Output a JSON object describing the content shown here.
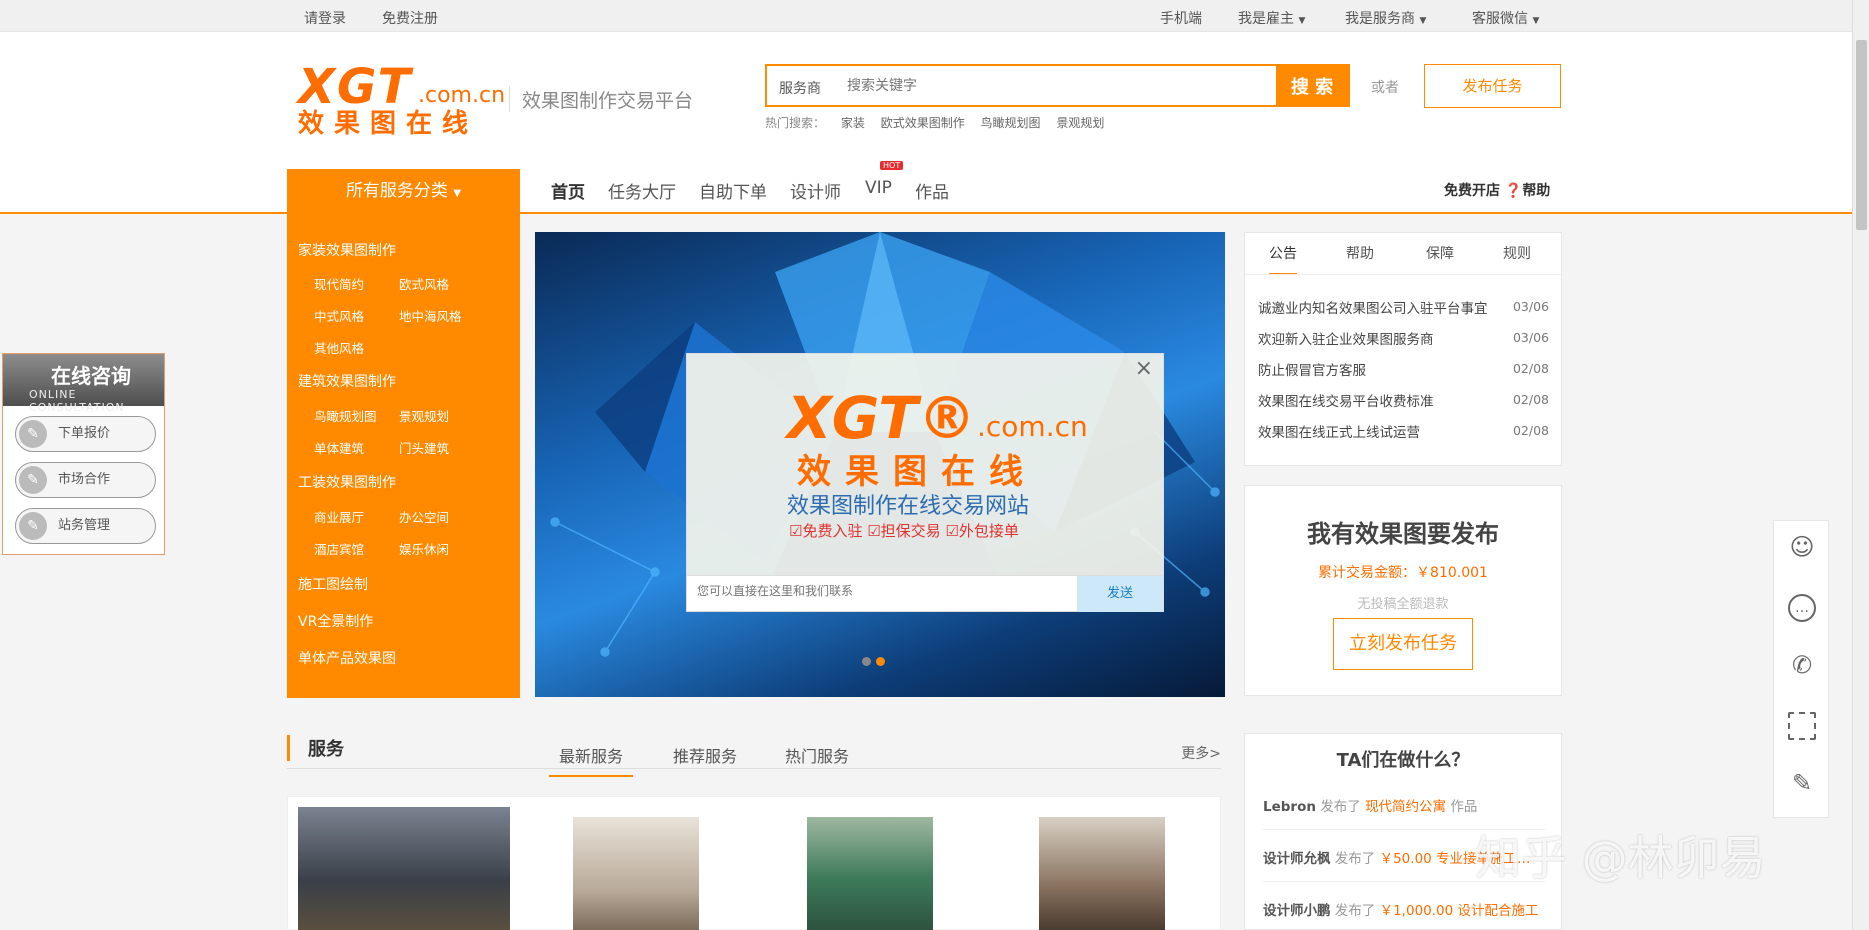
{
  "topbar": {
    "login": "请登录",
    "register": "免费注册",
    "mobile": "手机端",
    "employer": "我是雇主",
    "provider": "我是服务商",
    "wechat": "客服微信"
  },
  "logo": {
    "big": "XGT",
    "domain": ".com.cn",
    "cn": "效果图在线"
  },
  "slogan": "效果图制作交易平台",
  "search": {
    "category": "服务商",
    "placeholder": "搜索关键字",
    "button": "搜 索",
    "hot_label": "热门搜索：",
    "hot_terms": [
      "家装",
      "欧式效果图制作",
      "鸟瞰规划图",
      "景观规划"
    ]
  },
  "or_text": "或者",
  "publish_task": "发布任务",
  "nav": {
    "all_categories": "所有服务分类",
    "links": [
      "首页",
      "任务大厅",
      "自助下单",
      "设计师",
      "VIP",
      "作品"
    ],
    "hot_badge": "HOT",
    "free_shop": "免费开店",
    "help": "帮助"
  },
  "side_menu": {
    "groups": [
      {
        "title": "家装效果图制作",
        "subs": [
          "现代简约",
          "欧式风格",
          "中式风格",
          "地中海风格",
          "其他风格"
        ]
      },
      {
        "title": "建筑效果图制作",
        "subs": [
          "鸟瞰规划图",
          "景观规划",
          "单体建筑",
          "门头建筑"
        ]
      },
      {
        "title": "工装效果图制作",
        "subs": [
          "商业展厅",
          "办公空间",
          "酒店宾馆",
          "娱乐休闲"
        ]
      },
      {
        "title": "施工图绘制",
        "subs": []
      },
      {
        "title": "VR全景制作",
        "subs": []
      },
      {
        "title": "单体产品效果图",
        "subs": []
      }
    ]
  },
  "popup": {
    "close": "×",
    "logo_big": "XGT®",
    "logo_domain": ".com.cn",
    "logo_cn": "效果图在线",
    "subtitle": "效果图制作在线交易网站",
    "checks": "☑免费入驻 ☑担保交易 ☑外包接单",
    "chat_placeholder": "您可以直接在这里和我们联系",
    "send": "发送"
  },
  "notice": {
    "tabs": [
      "公告",
      "帮助",
      "保障",
      "规则"
    ],
    "items": [
      {
        "text": "诚邀业内知名效果图公司入驻平台事宜",
        "date": "03/06"
      },
      {
        "text": "欢迎新入驻企业效果图服务商",
        "date": "03/06"
      },
      {
        "text": "防止假冒官方客服",
        "date": "02/08"
      },
      {
        "text": "效果图在线交易平台收费标准",
        "date": "02/08"
      },
      {
        "text": "效果图在线正式上线试运营",
        "date": "02/08"
      }
    ]
  },
  "publish_box": {
    "title": "我有效果图要发布",
    "amount": "累计交易金额：￥810.001",
    "refund": "无投稿全额退款",
    "button": "立刻发布任务"
  },
  "online": {
    "title": "在线咨询",
    "subtitle": "ONLINE CONSULTATION",
    "buttons": [
      "下单报价",
      "市场合作",
      "站务管理"
    ]
  },
  "services": {
    "title": "服务",
    "tabs": [
      "最新服务",
      "推荐服务",
      "热门服务"
    ],
    "more": "更多>"
  },
  "ta": {
    "title": "TA们在做什么？",
    "rows": [
      {
        "name": "Lebron",
        "verb": "发布了",
        "what": "现代简约公寓",
        "tail": "作品"
      },
      {
        "name": "设计师允枫",
        "verb": "发布了",
        "what": "￥50.00 专业接单施工…",
        "tail": ""
      },
      {
        "name": "设计师小鹏",
        "verb": "发布了",
        "what": "￥1,000.00 设计配合施工",
        "tail": ""
      }
    ]
  },
  "watermark": "知乎 @林卯易",
  "colors": {
    "accent": "#ff8a00",
    "brand_orange": "#ff6d00"
  }
}
